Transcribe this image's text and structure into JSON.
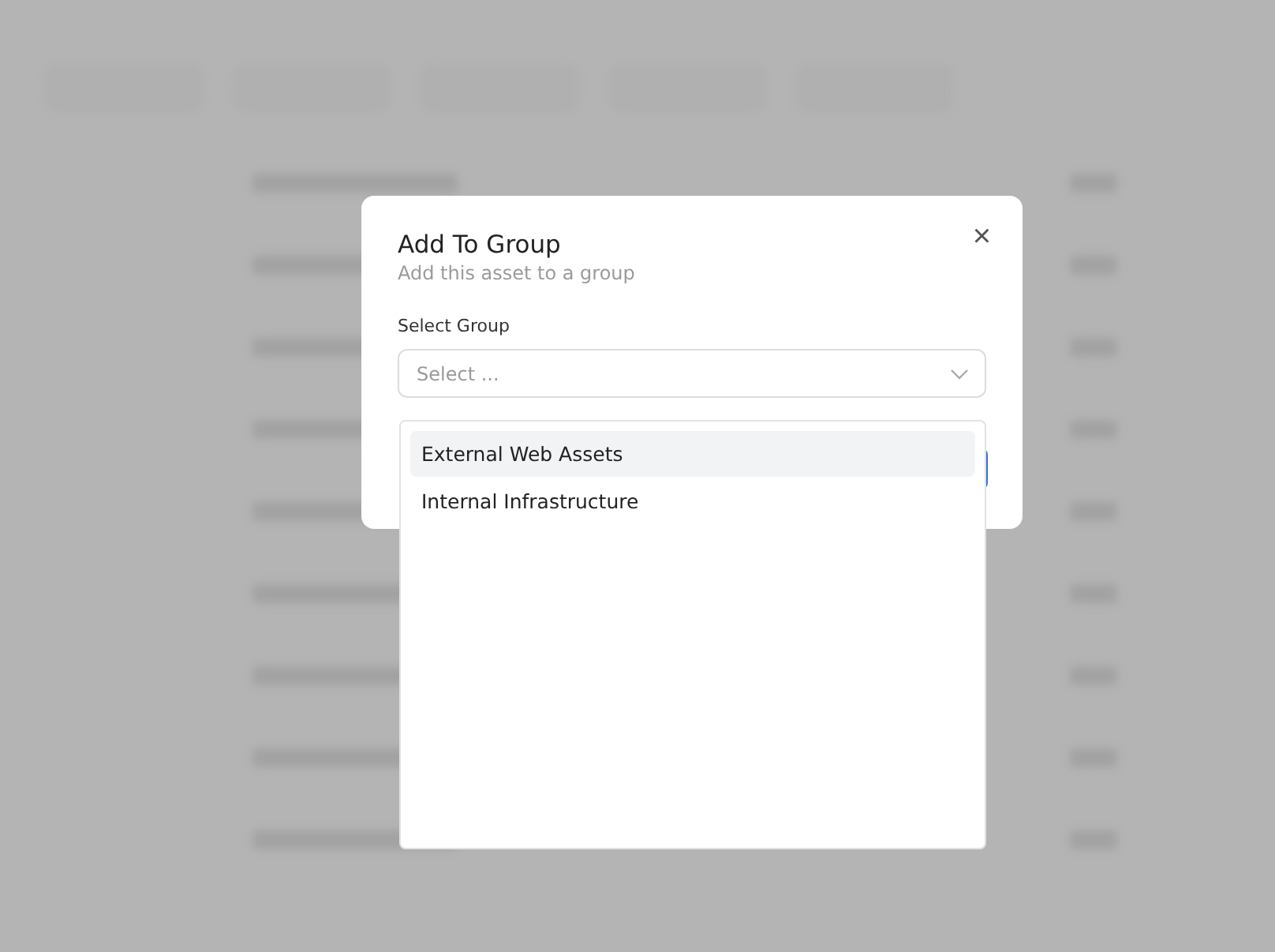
{
  "dialog": {
    "title": "Add To Group",
    "subtitle": "Add this asset to a group",
    "close": "×",
    "field_label": "Select Group",
    "select": {
      "placeholder": "Select ..."
    },
    "options": [
      {
        "label": "External Web Assets",
        "selected": true
      },
      {
        "label": "Internal Infrastructure",
        "selected": false
      }
    ]
  }
}
